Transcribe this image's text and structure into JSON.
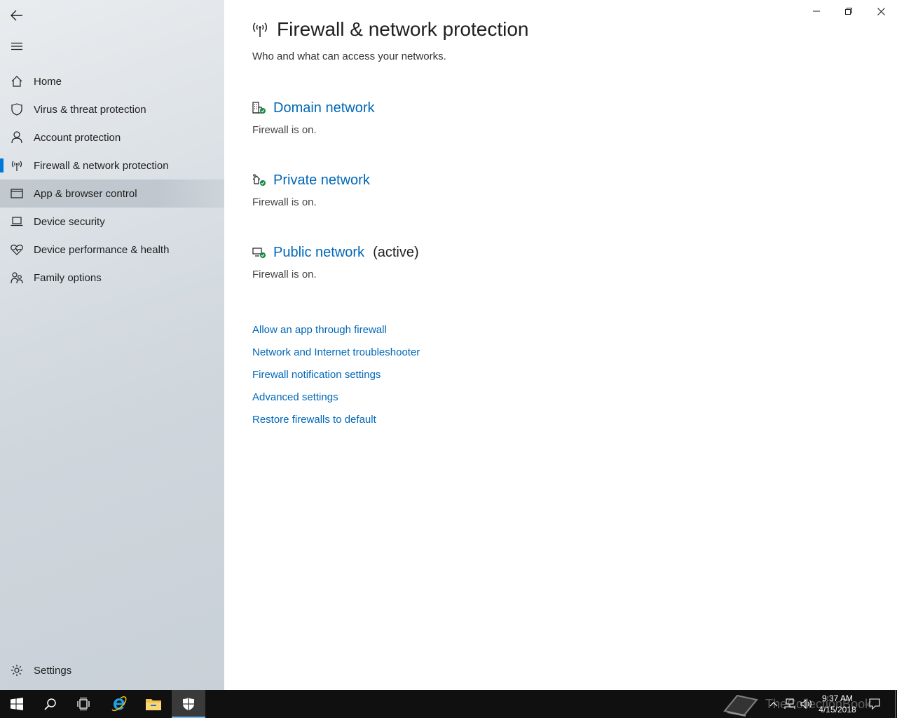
{
  "window": {
    "title": "Firewall & network protection",
    "controls": {
      "minimize": "minimize",
      "restore": "restore",
      "close": "close"
    }
  },
  "sidebar": {
    "items": [
      {
        "label": "Home",
        "icon": "home-icon"
      },
      {
        "label": "Virus & threat protection",
        "icon": "shield-icon"
      },
      {
        "label": "Account protection",
        "icon": "person-icon"
      },
      {
        "label": "Firewall & network protection",
        "icon": "antenna-icon",
        "selected": true
      },
      {
        "label": "App & browser control",
        "icon": "app-window-icon",
        "hover": true
      },
      {
        "label": "Device security",
        "icon": "laptop-icon"
      },
      {
        "label": "Device performance & health",
        "icon": "heart-pulse-icon"
      },
      {
        "label": "Family options",
        "icon": "family-icon"
      }
    ],
    "settings_label": "Settings"
  },
  "main": {
    "title": "Firewall & network protection",
    "subtitle": "Who and what can access your networks.",
    "networks": [
      {
        "name": "Domain network",
        "status": "Firewall is on.",
        "active_label": ""
      },
      {
        "name": "Private network",
        "status": "Firewall is on.",
        "active_label": ""
      },
      {
        "name": "Public network",
        "status": "Firewall is on.",
        "active_label": "(active)"
      }
    ],
    "links": [
      "Allow an app through firewall",
      "Network and Internet troubleshooter",
      "Firewall notification settings",
      "Advanced settings",
      "Restore firewalls to default"
    ]
  },
  "taskbar": {
    "time": "9:37 AM",
    "date": "4/15/2018",
    "watermark": "TheCollectionBook"
  },
  "colors": {
    "accent": "#0078d7",
    "link": "#0067b8",
    "status_ok": "#10893e"
  }
}
